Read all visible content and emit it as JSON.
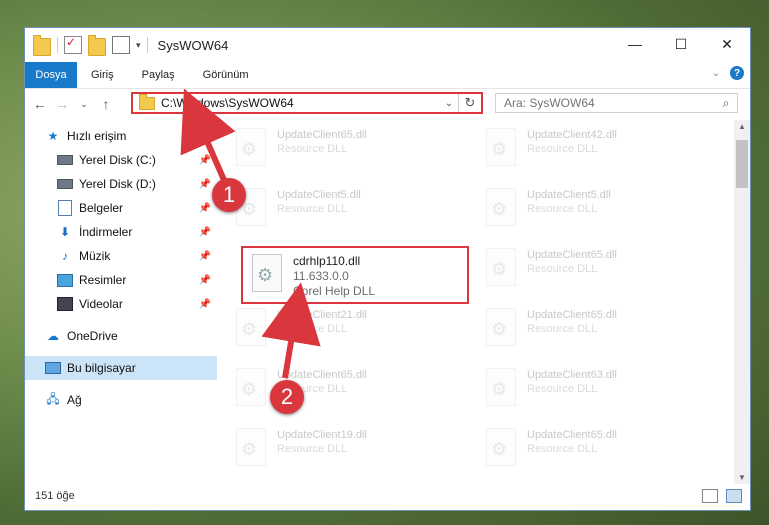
{
  "window": {
    "title": "SysWOW64",
    "controls": {
      "minimize": "—",
      "maximize": "☐",
      "close": "✕"
    }
  },
  "ribbon": {
    "file_tab": "Dosya",
    "tabs": [
      "Giriş",
      "Paylaş",
      "Görünüm"
    ]
  },
  "navigation": {
    "address": "C:\\Windows\\SysWOW64",
    "search_placeholder": "Ara: SysWOW64"
  },
  "sidebar": {
    "items": [
      {
        "label": "Hızlı erişim",
        "icon": "star-icon"
      },
      {
        "label": "Yerel Disk (C:)",
        "icon": "drive-icon",
        "pinned": true
      },
      {
        "label": "Yerel Disk (D:)",
        "icon": "drive-icon",
        "pinned": true
      },
      {
        "label": "Belgeler",
        "icon": "documents-icon",
        "pinned": true
      },
      {
        "label": "İndirmeler",
        "icon": "downloads-icon",
        "pinned": true
      },
      {
        "label": "Müzik",
        "icon": "music-icon",
        "pinned": true
      },
      {
        "label": "Resimler",
        "icon": "pictures-icon",
        "pinned": true
      },
      {
        "label": "Videolar",
        "icon": "videos-icon",
        "pinned": true
      },
      {
        "label": "OneDrive",
        "icon": "cloud-icon"
      },
      {
        "label": "Bu bilgisayar",
        "icon": "pc-icon",
        "selected": true
      },
      {
        "label": "Ağ",
        "icon": "network-icon"
      }
    ]
  },
  "files": {
    "left": [
      {
        "name": "UpdateClient65.dll",
        "type": "Resource DLL"
      },
      {
        "name": "UpdateClient5.dll",
        "type": "Resource DLL"
      },
      {
        "name": "UpdateClient21.dll",
        "type": "Resource DLL"
      },
      {
        "name": "UpdateClient65.dll",
        "type": "Resource DLL"
      },
      {
        "name": "UpdateClient19.dll",
        "type": "Resource DLL"
      }
    ],
    "right": [
      {
        "name": "UpdateClient42.dll",
        "type": "Resource DLL"
      },
      {
        "name": "UpdateClient5.dll",
        "type": "Resource DLL"
      },
      {
        "name": "UpdateClient65.dll",
        "type": "Resource DLL"
      },
      {
        "name": "UpdateClient65.dll",
        "type": "Resource DLL"
      },
      {
        "name": "UpdateClient63.dll",
        "type": "Resource DLL"
      },
      {
        "name": "UpdateClient65.dll",
        "type": "Resource DLL"
      }
    ],
    "highlighted": {
      "name": "cdrhlp110.dll",
      "version": "11.633.0.0",
      "type": "Corel Help DLL"
    }
  },
  "status": {
    "count": "151 öğe"
  },
  "callouts": {
    "one": "1",
    "two": "2"
  },
  "colors": {
    "accent": "#1979ca",
    "highlight": "#d9363e"
  }
}
